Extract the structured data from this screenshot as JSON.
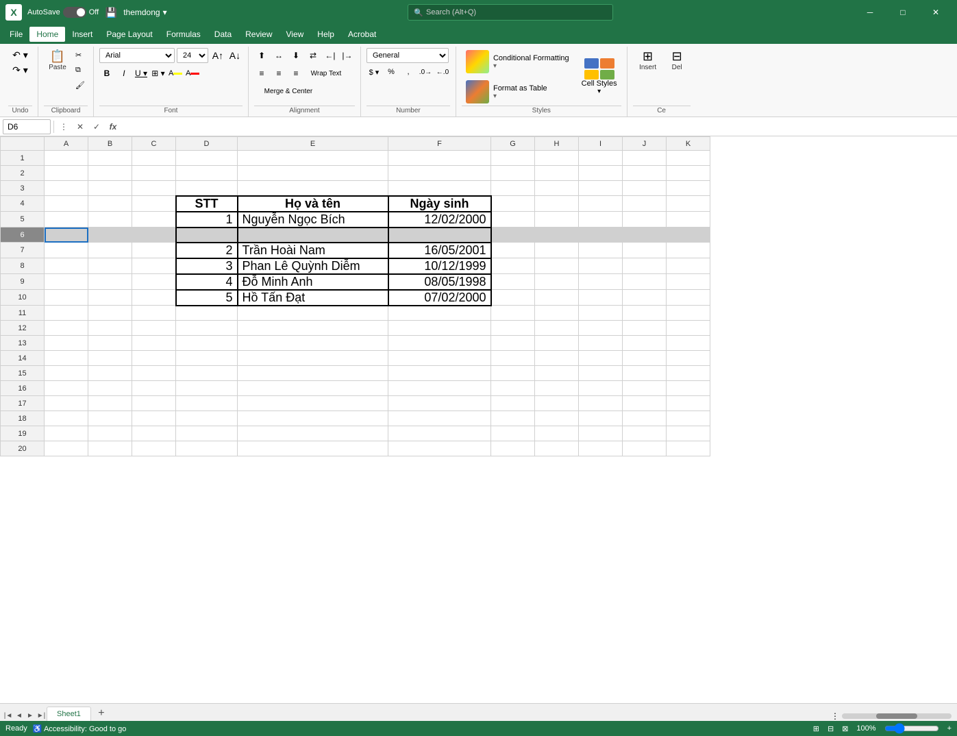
{
  "titleBar": {
    "logo": "X",
    "autosave_label": "AutoSave",
    "toggle_state": "Off",
    "filename": "themdong",
    "search_placeholder": "Search (Alt+Q)",
    "save_icon": "💾"
  },
  "menuBar": {
    "items": [
      {
        "label": "File",
        "active": false
      },
      {
        "label": "Home",
        "active": true
      },
      {
        "label": "Insert",
        "active": false
      },
      {
        "label": "Page Layout",
        "active": false
      },
      {
        "label": "Formulas",
        "active": false
      },
      {
        "label": "Data",
        "active": false
      },
      {
        "label": "Review",
        "active": false
      },
      {
        "label": "View",
        "active": false
      },
      {
        "label": "Help",
        "active": false
      },
      {
        "label": "Acrobat",
        "active": false
      }
    ]
  },
  "ribbon": {
    "undo_label": "Undo",
    "clipboard_label": "Clipboard",
    "paste_label": "Paste",
    "cut_icon": "✂",
    "copy_icon": "⧉",
    "format_painter_icon": "🖌",
    "font_label": "Font",
    "font_name": "Arial",
    "font_size": "24",
    "bold_label": "B",
    "italic_label": "I",
    "underline_label": "U",
    "alignment_label": "Alignment",
    "wrap_text_label": "Wrap Text",
    "merge_center_label": "Merge & Center",
    "number_label": "Number",
    "number_format": "General",
    "styles_label": "Styles",
    "conditional_formatting_label": "Conditional Formatting",
    "format_as_table_label": "Format as Table",
    "cell_styles_label": "Cell Styles",
    "cells_label": "Ce",
    "insert_label": "Insert",
    "delete_label": "Del"
  },
  "formulaBar": {
    "cell_ref": "D6",
    "cancel_icon": "✕",
    "confirm_icon": "✓",
    "function_icon": "fx",
    "formula_value": ""
  },
  "columnHeaders": [
    "A",
    "B",
    "C",
    "D",
    "E",
    "F",
    "G",
    "H",
    "I",
    "J",
    "K"
  ],
  "rowCount": 20,
  "tableData": {
    "headers": {
      "stt": "STT",
      "hovaten": "Họ và tên",
      "ngaysinh": "Ngày sinh"
    },
    "rows": [
      {
        "stt": "1",
        "name": "Nguyễn Ngọc Bích",
        "dob": "12/02/2000"
      },
      {
        "stt": "",
        "name": "",
        "dob": ""
      },
      {
        "stt": "2",
        "name": "Trần Hoài Nam",
        "dob": "16/05/2001"
      },
      {
        "stt": "3",
        "name": "Phan Lê Quỳnh Diễm",
        "dob": "10/12/1999"
      },
      {
        "stt": "4",
        "name": "Đỗ Minh Anh",
        "dob": "08/05/1998"
      },
      {
        "stt": "5",
        "name": "Hồ Tấn Đạt",
        "dob": "07/02/2000"
      }
    ],
    "startRow": 4
  },
  "sheetTabs": [
    {
      "label": "Sheet1",
      "active": true
    }
  ],
  "statusBar": {
    "ready_label": "Ready",
    "accessibility_label": "Accessibility: Good to go"
  }
}
